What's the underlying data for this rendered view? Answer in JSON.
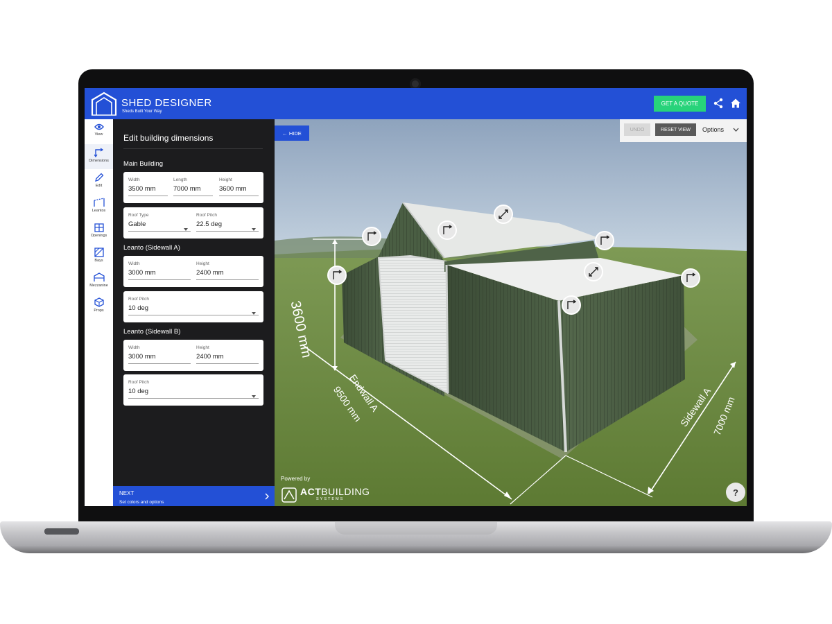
{
  "app": {
    "brand": "SHED DESIGNER",
    "tagline": "Sheds Built Your Way",
    "quote_label": "GET A QUOTE",
    "share_icon": "share-icon",
    "home_icon": "home-icon"
  },
  "nav": {
    "items": [
      {
        "label": "View",
        "icon": "eye-icon"
      },
      {
        "label": "Dimensions",
        "icon": "dimensions-icon"
      },
      {
        "label": "Edit",
        "icon": "pencil-icon"
      },
      {
        "label": "Leantos",
        "icon": "leanto-icon"
      },
      {
        "label": "Openings",
        "icon": "openings-icon"
      },
      {
        "label": "Bays",
        "icon": "bays-icon"
      },
      {
        "label": "Mezzanine",
        "icon": "mezzanine-icon"
      },
      {
        "label": "Props",
        "icon": "cube-icon"
      }
    ]
  },
  "panel": {
    "title": "Edit building dimensions",
    "main": {
      "heading": "Main Building",
      "width_label": "Width",
      "width_value": "3500 mm",
      "length_label": "Length",
      "length_value": "7000 mm",
      "height_label": "Height",
      "height_value": "3600 mm",
      "roof_type_label": "Roof Type",
      "roof_type_value": "Gable",
      "roof_pitch_label": "Roof Pitch",
      "roof_pitch_value": "22.5 deg"
    },
    "leanto_a": {
      "heading": "Leanto (Sidewall A)",
      "width_label": "Width",
      "width_value": "3000 mm",
      "height_label": "Height",
      "height_value": "2400 mm",
      "roof_pitch_label": "Roof Pitch",
      "roof_pitch_value": "10 deg"
    },
    "leanto_b": {
      "heading": "Leanto (Sidewall B)",
      "width_label": "Width",
      "width_value": "3000 mm",
      "height_label": "Height",
      "height_value": "2400 mm",
      "roof_pitch_label": "Roof Pitch",
      "roof_pitch_value": "10 deg"
    },
    "next_label": "NEXT",
    "next_sub": "Set colors and options"
  },
  "viewport": {
    "hide_label": "← HIDE",
    "undo_label": "UNDO",
    "reset_label": "RESET VIEW",
    "options_label": "Options",
    "powered_label": "Powered by",
    "brand_bold": "ACT",
    "brand_rest": "BUILDING",
    "brand_sub": "SYSTEMS",
    "help_label": "?",
    "height_dim": "3600 mm",
    "endwall_label": "Endwall A",
    "endwall_dim": "9500 mm",
    "sidewall_label": "Sidewall A",
    "sidewall_dim": "7000 mm"
  },
  "colors": {
    "accent": "#2350d6",
    "quote_green": "#27d37a",
    "panel_dark": "#1c1c1e",
    "wall_green": "#4a5e43",
    "roof_white": "#e6e8e6"
  }
}
